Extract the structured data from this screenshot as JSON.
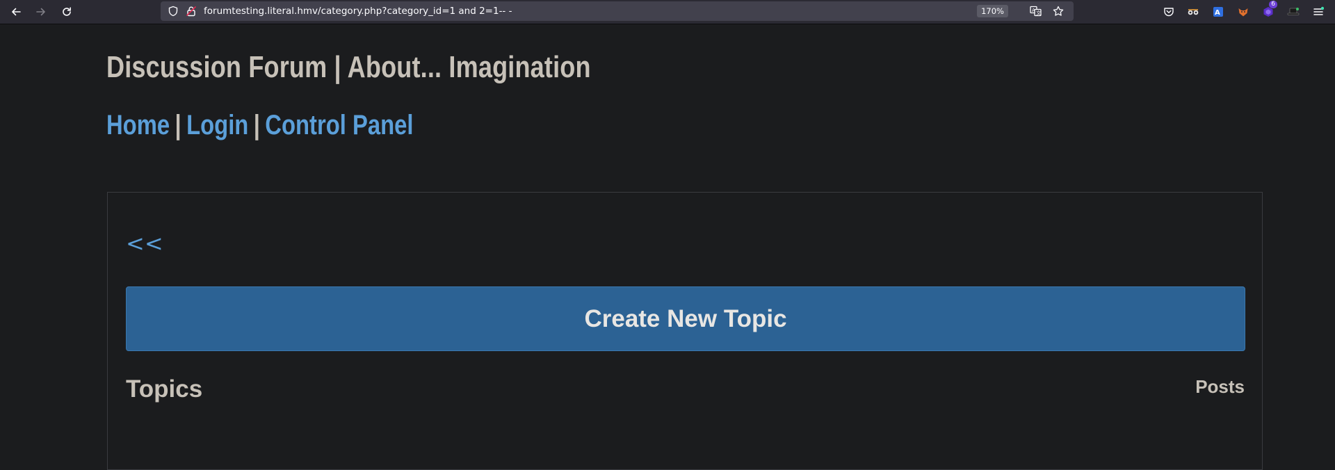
{
  "browser": {
    "url": "forumtesting.literal.hmv/category.php?category_id=1 and 2=1-- -",
    "zoom": "170%",
    "extension_badge_count": "6",
    "icons": {
      "back": "arrow-left-icon",
      "forward": "arrow-right-icon",
      "reload": "reload-icon",
      "shield": "shield-icon",
      "lock": "lock-icon",
      "translate": "translate-icon",
      "bookmark": "star-icon",
      "pocket": "pocket-icon",
      "menu": "hamburger-menu-icon"
    }
  },
  "site": {
    "title": "Discussion Forum | About... Imagination",
    "nav": {
      "home": "Home",
      "login": "Login",
      "control_panel": "Control Panel",
      "separator": "|"
    }
  },
  "content": {
    "back_link": "<<",
    "create_button": "Create New Topic",
    "topics_heading": "Topics",
    "posts_heading": "Posts"
  },
  "colors": {
    "page_background": "#1b1c1e",
    "link": "#5b9fd9",
    "text": "#c7c1b8",
    "button_background": "#2c6294"
  }
}
